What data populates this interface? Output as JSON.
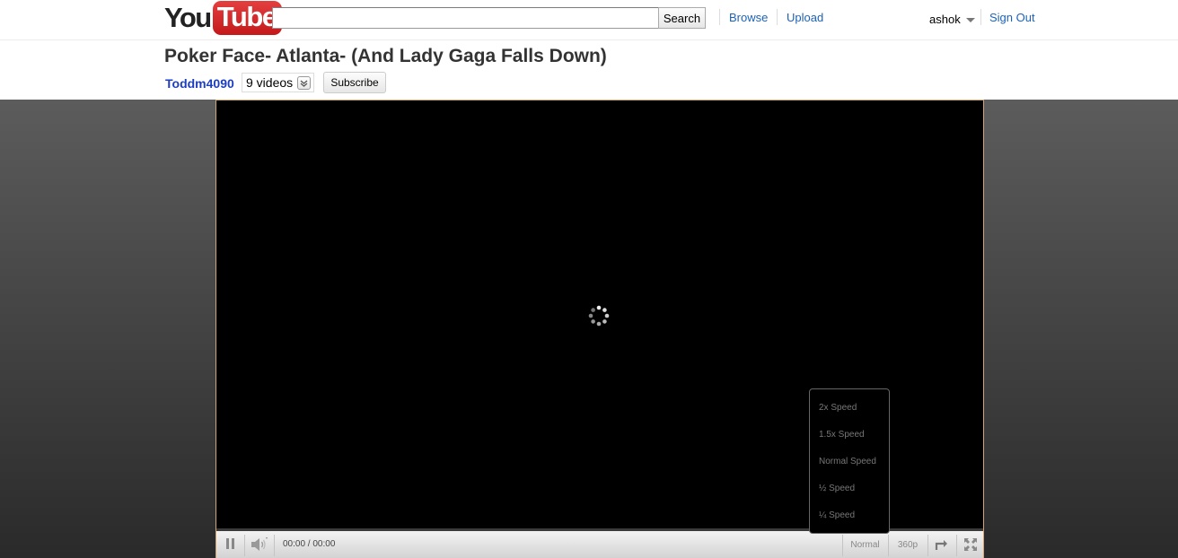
{
  "header": {
    "logo_you": "You",
    "logo_tube": "Tube",
    "search_placeholder": "",
    "search_value": "",
    "search_button": "Search",
    "nav": {
      "browse": "Browse",
      "upload": "Upload"
    },
    "username": "ashok",
    "sign_out": "Sign Out"
  },
  "video": {
    "title": "Poker Face- Atlanta- (And Lady Gaga Falls Down)",
    "channel": "Toddm4090",
    "videos_count": "9 videos",
    "subscribe": "Subscribe"
  },
  "player": {
    "time": "00:00 / 00:00",
    "speed_label": "Normal",
    "quality_label": "360p",
    "speed_menu": [
      "2x Speed",
      "1.5x Speed",
      "Normal Speed",
      "½ Speed",
      "¼ Speed"
    ],
    "loading": true
  },
  "colors": {
    "link": "#1c62b9",
    "channel": "#1c3fc0",
    "logo_red": "#d8262b",
    "player_border": "#d5a46f"
  },
  "icons": [
    "chevron-down-icon",
    "caret-down-icon",
    "loading-spinner-icon",
    "pause-icon",
    "volume-icon",
    "loop-icon",
    "fullscreen-icon"
  ]
}
